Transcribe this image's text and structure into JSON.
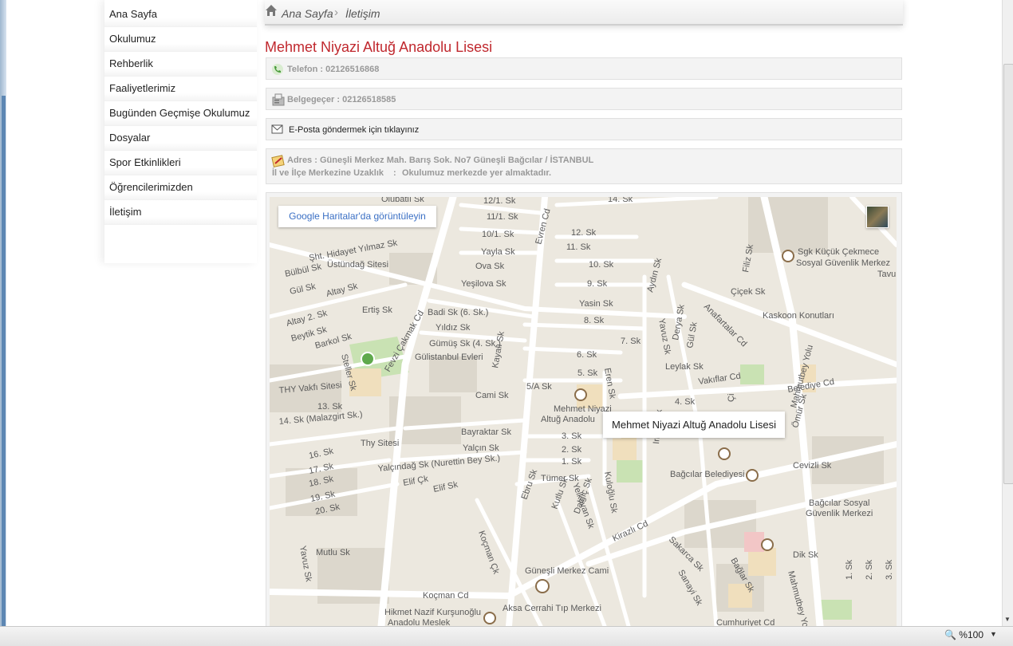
{
  "breadcrumb": {
    "home": "Ana Sayfa",
    "current": "İletişim"
  },
  "sidebar": {
    "items": [
      {
        "label": "Ana Sayfa"
      },
      {
        "label": "Okulumuz"
      },
      {
        "label": "Rehberlik"
      },
      {
        "label": "Faaliyetlerimiz"
      },
      {
        "label": "Bugünden Geçmişe Okulumuz"
      },
      {
        "label": "Dosyalar"
      },
      {
        "label": "Spor Etkinlikleri"
      },
      {
        "label": "Öğrencilerimizden"
      },
      {
        "label": "İletişim"
      }
    ]
  },
  "page": {
    "title": "Mehmet Niyazi Altuğ Anadolu Lisesi",
    "phone": "Telefon : 02126516868",
    "fax": "Belgegeçer : 02126518585",
    "email": "E-Posta göndermek için tıklayınız",
    "address": "Adres : Güneşli Merkez Mah. Barış Sok. No7 Güneşli Bağcılar / İSTANBUL",
    "distance_label": "İl ve İlçe Merkezine Uzaklık",
    "distance_sep": ":",
    "distance_value": "Okulumuz merkezde yer almaktadır."
  },
  "map": {
    "link": "Google Haritalar'da görüntüleyin",
    "popup": "Mehmet Niyazi Altuğ Anadolu Lisesi",
    "labels": [
      "Olubatlı Sk",
      "12/1. Sk",
      "14. Sk",
      "11/1. Sk",
      "12. Sk",
      "10/1. Sk",
      "11. Sk",
      "Yayla Sk",
      "Şht. Hidayet Yılmaz Sk",
      "Üstündağ Sitesi",
      "Ova Sk",
      "10. Sk",
      "Bülbül Sk",
      "Yeşilova Sk",
      "9. Sk",
      "Gül Sk",
      "Evren Cd",
      "Altay Sk",
      "Yasin Sk",
      "Ertiş Sk",
      "Badi Sk (6. Sk.)",
      "Altay 2. Sk",
      "Yıldız Sk",
      "8. Sk",
      "Beytik Sk",
      "Barkol Sk",
      "Gümüş Sk (4. Sk.)",
      "7. Sk",
      "Gülistanbul Evleri",
      "6. Sk",
      "Steller Sk",
      "Fevzi Çakmak Cd",
      "Kayalı Sk",
      "5. Sk",
      "THY Vakfı Sitesi",
      "Cami Sk",
      "5/A Sk",
      "13. Sk",
      "Mehmet Niyazi",
      "Altuğ Anadolu",
      "14. Sk (Malazgirt Sk.)",
      "Bayraktar Sk",
      "3. Sk",
      "Thy Sitesi",
      "Yalçın Sk",
      "2. Sk",
      "16. Sk",
      "1. Sk",
      "17. Sk",
      "Yalçındağ Sk (Nurettin Bey Sk.)",
      "Tümer Sk",
      "18. Sk",
      "Elif Çk",
      "19. Sk",
      "Elif Sk",
      "20. Sk",
      "Ebru Sk",
      "Kutlu Sk",
      "Dalgıç Sk",
      "Koçman Çk",
      "Yelkovan Sk",
      "Kuloğlu Sk",
      "Kirazlı Cd",
      "Yavuz Sk",
      "Mutlu Sk",
      "Güneşli Merkez Cami",
      "Koçman Cd",
      "Aksa Cerrahi Tıp Merkezi",
      "Hikmet Nazif Kurşunoğlu",
      "Anadolu Meslek",
      "Sgk Küçük Çekmece",
      "Sosyal Güvenlik Merkez",
      "Tavu",
      "Filiz Sk",
      "Çiçek Sk",
      "Aydın Sk",
      "Kaskoon Konutları",
      "Derya Sk",
      "Anafartalar Cd",
      "Gül Sk",
      "Leylak Sk",
      "Vakıflar Cd",
      "Mahmutbey Yolu",
      "4. Sk",
      "Belediye Cd",
      "Ömür Sk",
      "Bağcılar Belediyesi",
      "Cevizli Sk",
      "Bağcılar Sosyal",
      "Güvenlik Merkezi",
      "Sakarca Sk",
      "Sanayi Sk",
      "Bağlar Sk",
      "Dik Sk",
      "Cumhuriyet Cd",
      "Mahmutbey Yolu",
      "1. Sk",
      "2. Sk",
      "3. Sk",
      "Eren Sk",
      "Irmaz Sk",
      "Çi",
      "Yavuz Sk"
    ]
  },
  "status": {
    "zoom": "%100"
  },
  "colors": {
    "title": "#c0282e",
    "link": "#3a6fc4",
    "map_bg": "#ece8df"
  }
}
